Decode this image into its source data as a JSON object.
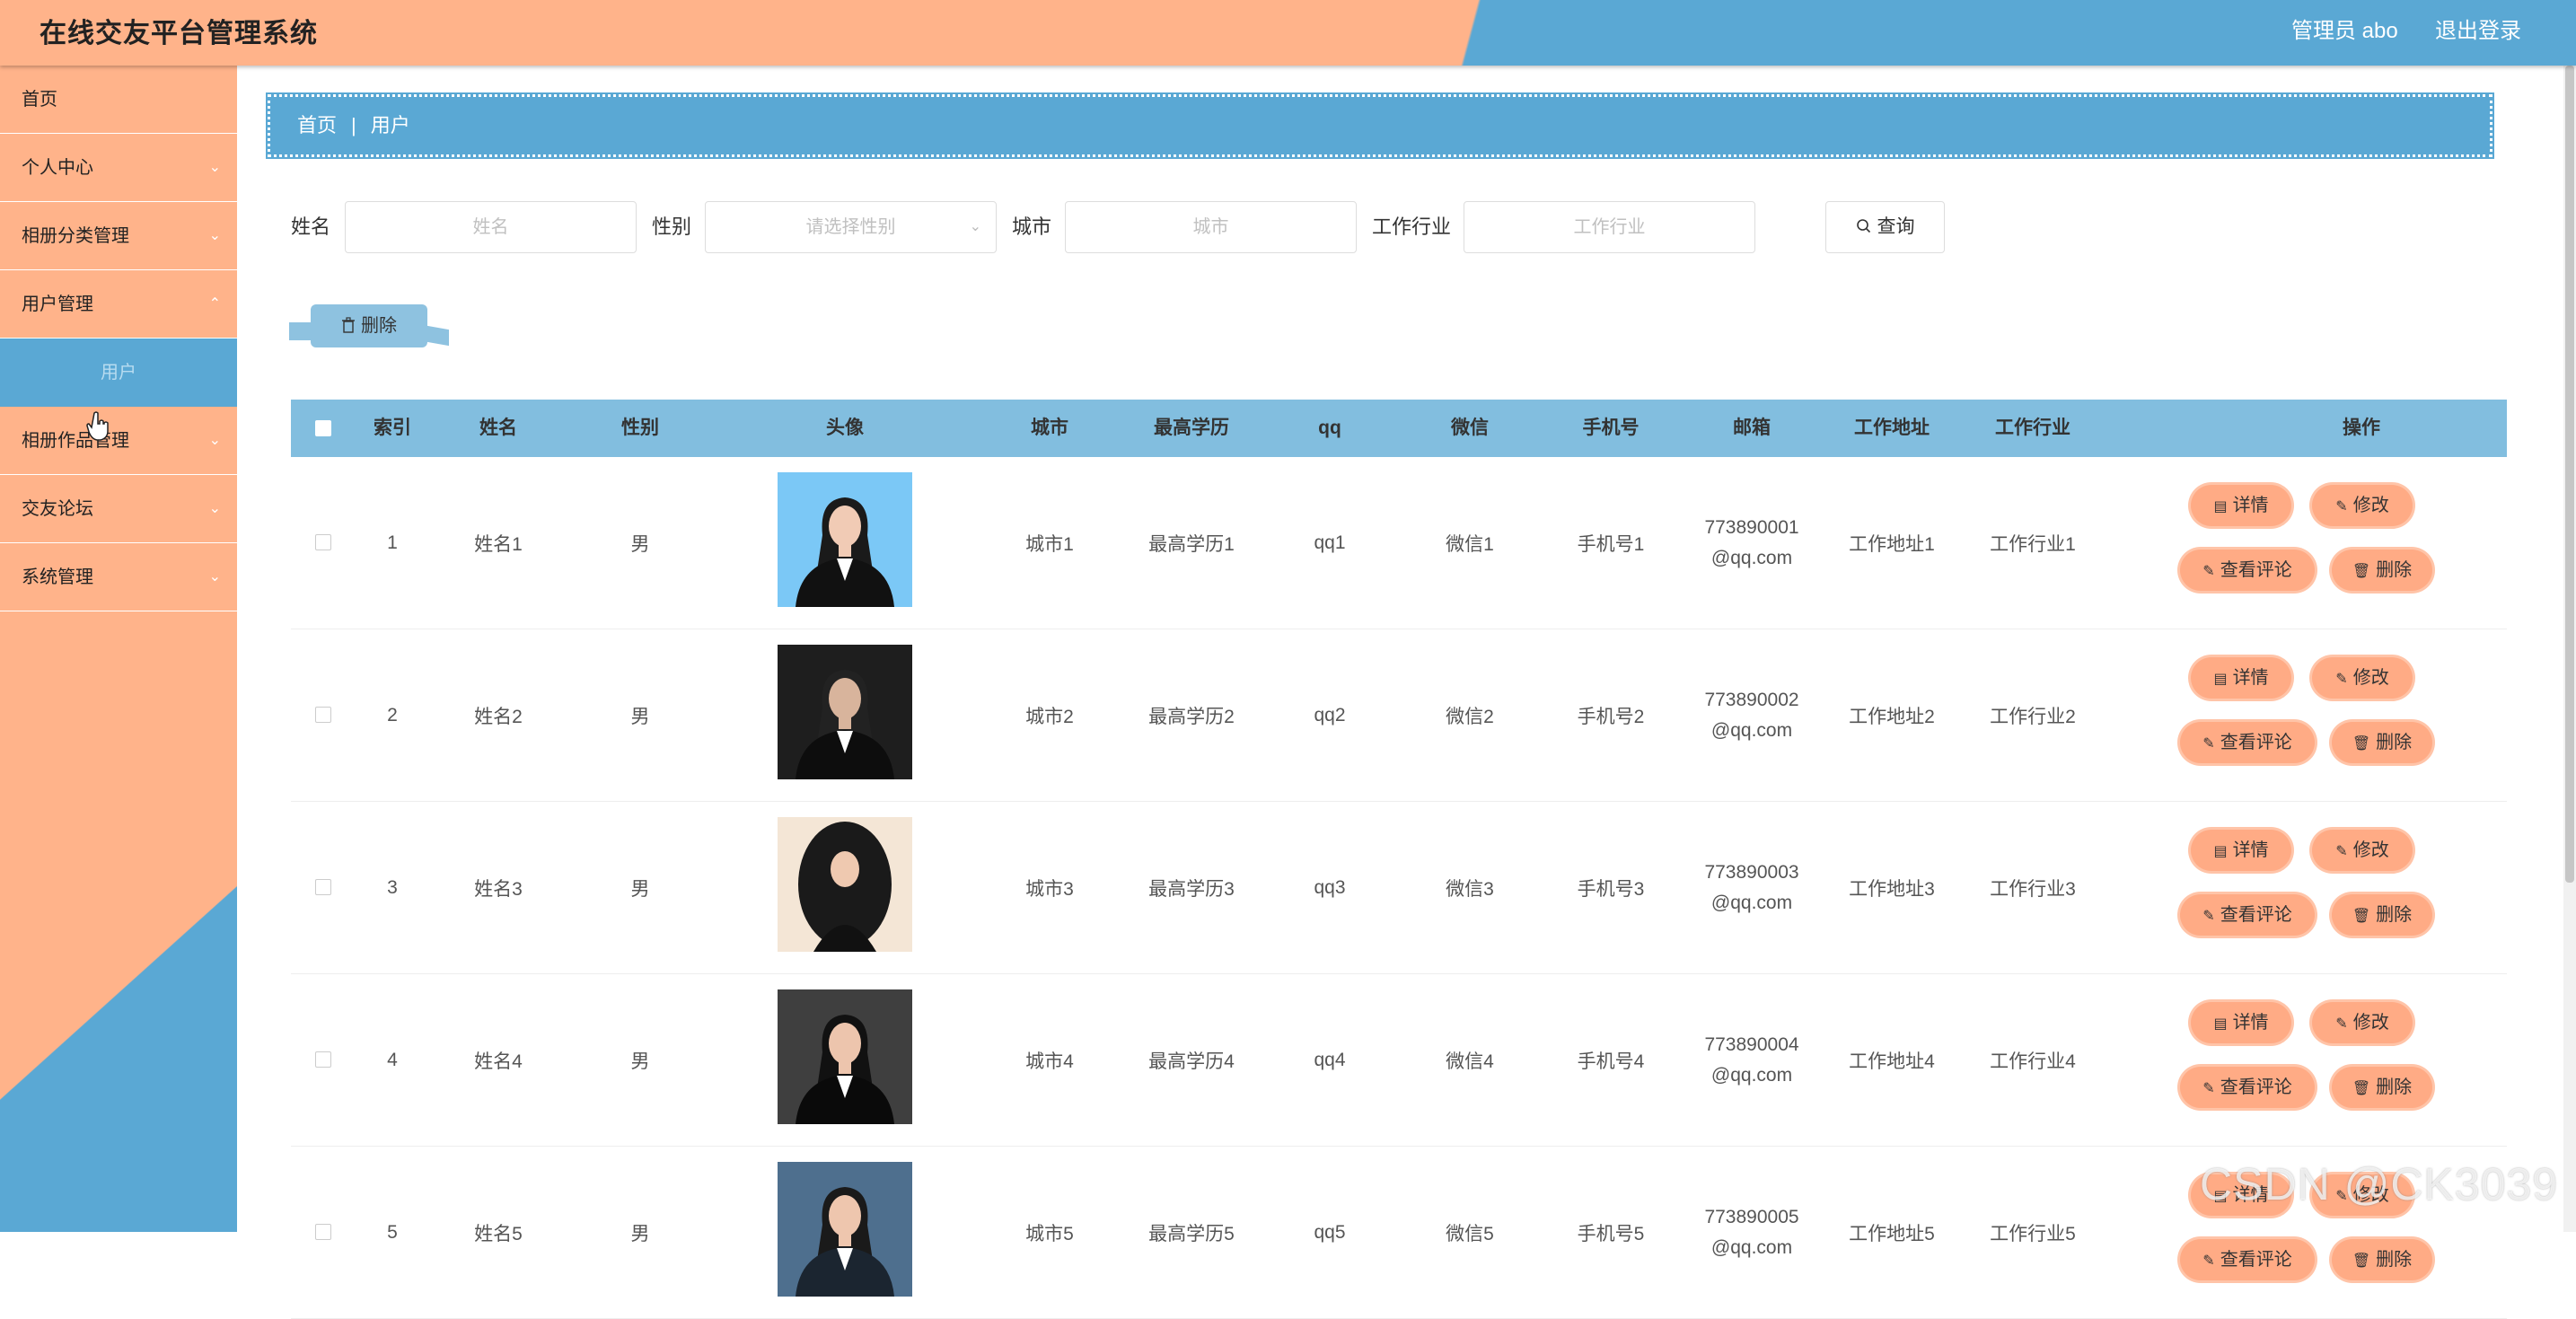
{
  "header": {
    "title": "在线交友平台管理系统",
    "admin": "管理员 abo",
    "logout": "退出登录"
  },
  "sidebar": {
    "items": [
      {
        "label": "首页",
        "has_chevron": false
      },
      {
        "label": "个人中心",
        "has_chevron": true
      },
      {
        "label": "相册分类管理",
        "has_chevron": true
      },
      {
        "label": "用户管理",
        "has_chevron": true
      },
      {
        "label": "相册作品管理",
        "has_chevron": true
      },
      {
        "label": "交友论坛",
        "has_chevron": true
      },
      {
        "label": "系统管理",
        "has_chevron": true
      }
    ],
    "active_sub": "用户"
  },
  "breadcrumb": {
    "home": "首页",
    "separator": "|",
    "current": "用户"
  },
  "search": {
    "name_label": "姓名",
    "name_placeholder": "姓名",
    "gender_label": "性别",
    "gender_placeholder": "请选择性别",
    "city_label": "城市",
    "city_placeholder": "城市",
    "industry_label": "工作行业",
    "industry_placeholder": "工作行业",
    "query_button": "查询"
  },
  "bulk_delete": "删除",
  "table": {
    "headers": [
      "索引",
      "姓名",
      "性别",
      "头像",
      "城市",
      "最高学历",
      "qq",
      "微信",
      "手机号",
      "邮箱",
      "工作地址",
      "工作行业",
      "操作"
    ],
    "rows": [
      {
        "index": "1",
        "name": "姓名1",
        "gender": "男",
        "city": "城市1",
        "edu": "最高学历1",
        "qq": "qq1",
        "wechat": "微信1",
        "phone": "手机号1",
        "email_a": "773890001",
        "email_b": "@qq.com",
        "addr": "工作地址1",
        "industry": "工作行业1"
      },
      {
        "index": "2",
        "name": "姓名2",
        "gender": "男",
        "city": "城市2",
        "edu": "最高学历2",
        "qq": "qq2",
        "wechat": "微信2",
        "phone": "手机号2",
        "email_a": "773890002",
        "email_b": "@qq.com",
        "addr": "工作地址2",
        "industry": "工作行业2"
      },
      {
        "index": "3",
        "name": "姓名3",
        "gender": "男",
        "city": "城市3",
        "edu": "最高学历3",
        "qq": "qq3",
        "wechat": "微信3",
        "phone": "手机号3",
        "email_a": "773890003",
        "email_b": "@qq.com",
        "addr": "工作地址3",
        "industry": "工作行业3"
      },
      {
        "index": "4",
        "name": "姓名4",
        "gender": "男",
        "city": "城市4",
        "edu": "最高学历4",
        "qq": "qq4",
        "wechat": "微信4",
        "phone": "手机号4",
        "email_a": "773890004",
        "email_b": "@qq.com",
        "addr": "工作地址4",
        "industry": "工作行业4"
      },
      {
        "index": "5",
        "name": "姓名5",
        "gender": "男",
        "city": "城市5",
        "edu": "最高学历5",
        "qq": "qq5",
        "wechat": "微信5",
        "phone": "手机号5",
        "email_a": "773890005",
        "email_b": "@qq.com",
        "addr": "工作地址5",
        "industry": "工作行业5"
      }
    ],
    "actions": {
      "detail": "详情",
      "edit": "修改",
      "comments": "查看评论",
      "delete": "删除"
    }
  },
  "watermark": "CSDN @CK3039",
  "colors": {
    "peach": "#ffb38a",
    "blue": "#5aa8d4",
    "header_blue": "#82bedf",
    "button_peach": "#ffab85"
  }
}
